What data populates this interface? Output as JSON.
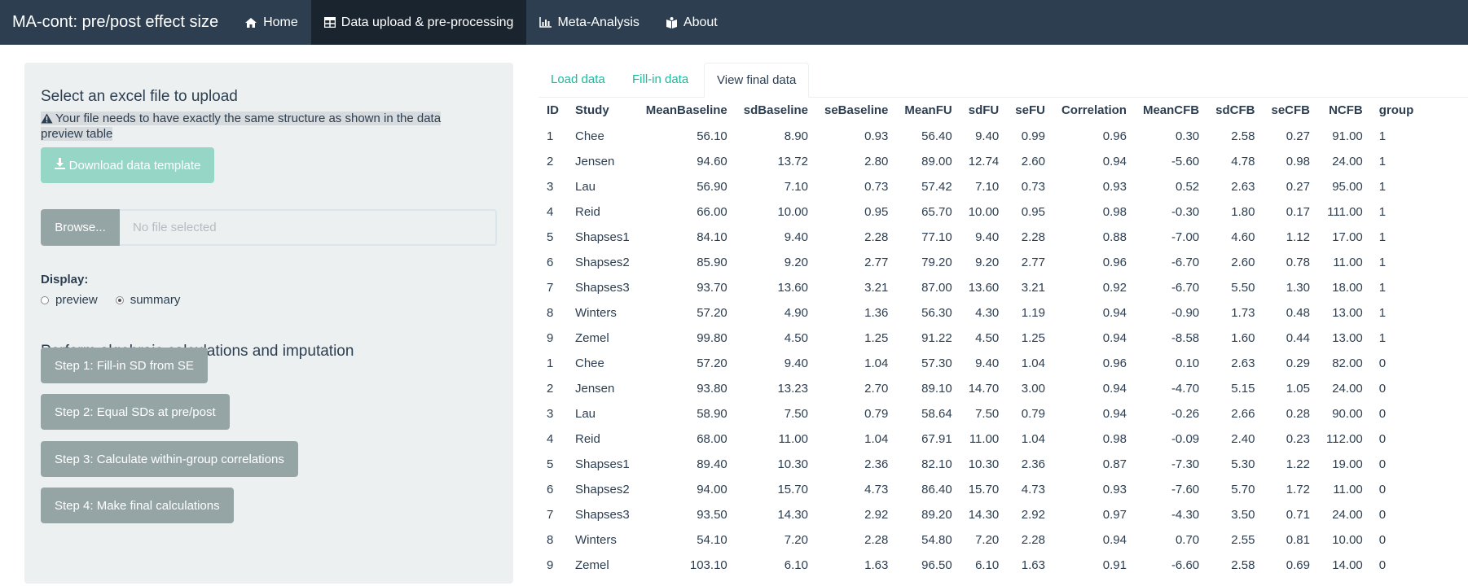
{
  "navbar": {
    "brand": "MA-cont: pre/post effect size",
    "items": [
      {
        "label": "Home",
        "icon": "home-icon",
        "active": false
      },
      {
        "label": "Data upload & pre-processing",
        "icon": "table-icon",
        "active": true
      },
      {
        "label": "Meta-Analysis",
        "icon": "bar-chart-icon",
        "active": false
      },
      {
        "label": "About",
        "icon": "book-icon",
        "active": false
      }
    ]
  },
  "sidebar": {
    "upload_heading": "Select an excel file to upload",
    "note": "Your file needs to have exactly the same structure as shown in the data preview table",
    "download_button": "Download data template",
    "browse_button": "Browse...",
    "file_placeholder": "No file selected",
    "display_label": "Display:",
    "display_options": [
      {
        "label": "preview",
        "checked": false
      },
      {
        "label": "summary",
        "checked": true
      }
    ],
    "calc_heading": "Perform algebraic calculations and imputation",
    "steps": [
      "Step 1: Fill-in SD from SE",
      "Step 2: Equal SDs at pre/post",
      "Step 3: Calculate within-group correlations",
      "Step 4: Make final calculations"
    ]
  },
  "tabs": [
    {
      "label": "Load data",
      "active": false
    },
    {
      "label": "Fill-in data",
      "active": false
    },
    {
      "label": "View final data",
      "active": true
    }
  ],
  "table": {
    "columns": [
      "ID",
      "Study",
      "MeanBaseline",
      "sdBaseline",
      "seBaseline",
      "MeanFU",
      "sdFU",
      "seFU",
      "Correlation",
      "MeanCFB",
      "sdCFB",
      "seCFB",
      "NCFB",
      "group"
    ],
    "rows": [
      [
        "1",
        "Chee",
        "56.10",
        "8.90",
        "0.93",
        "56.40",
        "9.40",
        "0.99",
        "0.96",
        "0.30",
        "2.58",
        "0.27",
        "91.00",
        "1"
      ],
      [
        "2",
        "Jensen",
        "94.60",
        "13.72",
        "2.80",
        "89.00",
        "12.74",
        "2.60",
        "0.94",
        "-5.60",
        "4.78",
        "0.98",
        "24.00",
        "1"
      ],
      [
        "3",
        "Lau",
        "56.90",
        "7.10",
        "0.73",
        "57.42",
        "7.10",
        "0.73",
        "0.93",
        "0.52",
        "2.63",
        "0.27",
        "95.00",
        "1"
      ],
      [
        "4",
        "Reid",
        "66.00",
        "10.00",
        "0.95",
        "65.70",
        "10.00",
        "0.95",
        "0.98",
        "-0.30",
        "1.80",
        "0.17",
        "111.00",
        "1"
      ],
      [
        "5",
        "Shapses1",
        "84.10",
        "9.40",
        "2.28",
        "77.10",
        "9.40",
        "2.28",
        "0.88",
        "-7.00",
        "4.60",
        "1.12",
        "17.00",
        "1"
      ],
      [
        "6",
        "Shapses2",
        "85.90",
        "9.20",
        "2.77",
        "79.20",
        "9.20",
        "2.77",
        "0.96",
        "-6.70",
        "2.60",
        "0.78",
        "11.00",
        "1"
      ],
      [
        "7",
        "Shapses3",
        "93.70",
        "13.60",
        "3.21",
        "87.00",
        "13.60",
        "3.21",
        "0.92",
        "-6.70",
        "5.50",
        "1.30",
        "18.00",
        "1"
      ],
      [
        "8",
        "Winters",
        "57.20",
        "4.90",
        "1.36",
        "56.30",
        "4.30",
        "1.19",
        "0.94",
        "-0.90",
        "1.73",
        "0.48",
        "13.00",
        "1"
      ],
      [
        "9",
        "Zemel",
        "99.80",
        "4.50",
        "1.25",
        "91.22",
        "4.50",
        "1.25",
        "0.94",
        "-8.58",
        "1.60",
        "0.44",
        "13.00",
        "1"
      ],
      [
        "1",
        "Chee",
        "57.20",
        "9.40",
        "1.04",
        "57.30",
        "9.40",
        "1.04",
        "0.96",
        "0.10",
        "2.63",
        "0.29",
        "82.00",
        "0"
      ],
      [
        "2",
        "Jensen",
        "93.80",
        "13.23",
        "2.70",
        "89.10",
        "14.70",
        "3.00",
        "0.94",
        "-4.70",
        "5.15",
        "1.05",
        "24.00",
        "0"
      ],
      [
        "3",
        "Lau",
        "58.90",
        "7.50",
        "0.79",
        "58.64",
        "7.50",
        "0.79",
        "0.94",
        "-0.26",
        "2.66",
        "0.28",
        "90.00",
        "0"
      ],
      [
        "4",
        "Reid",
        "68.00",
        "11.00",
        "1.04",
        "67.91",
        "11.00",
        "1.04",
        "0.98",
        "-0.09",
        "2.40",
        "0.23",
        "112.00",
        "0"
      ],
      [
        "5",
        "Shapses1",
        "89.40",
        "10.30",
        "2.36",
        "82.10",
        "10.30",
        "2.36",
        "0.87",
        "-7.30",
        "5.30",
        "1.22",
        "19.00",
        "0"
      ],
      [
        "6",
        "Shapses2",
        "94.00",
        "15.70",
        "4.73",
        "86.40",
        "15.70",
        "4.73",
        "0.93",
        "-7.60",
        "5.70",
        "1.72",
        "11.00",
        "0"
      ],
      [
        "7",
        "Shapses3",
        "93.50",
        "14.30",
        "2.92",
        "89.20",
        "14.30",
        "2.92",
        "0.97",
        "-4.30",
        "3.50",
        "0.71",
        "24.00",
        "0"
      ],
      [
        "8",
        "Winters",
        "54.10",
        "7.20",
        "2.28",
        "54.80",
        "7.20",
        "2.28",
        "0.94",
        "0.70",
        "2.55",
        "0.81",
        "10.00",
        "0"
      ],
      [
        "9",
        "Zemel",
        "103.10",
        "6.10",
        "1.63",
        "96.50",
        "6.10",
        "1.63",
        "0.91",
        "-6.60",
        "2.58",
        "0.69",
        "14.00",
        "0"
      ]
    ]
  }
}
